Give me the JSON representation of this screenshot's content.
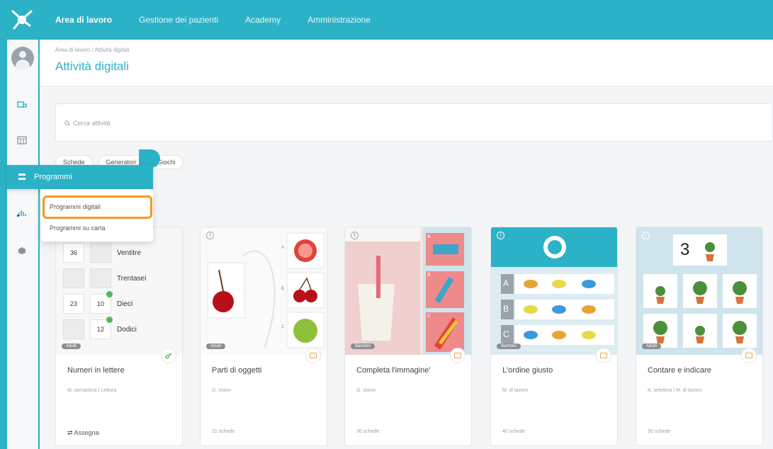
{
  "topnav": {
    "items": [
      {
        "label": "Area di lavoro",
        "active": true
      },
      {
        "label": "Gestione dei pazienti",
        "active": false
      },
      {
        "label": "Academy",
        "active": false
      },
      {
        "label": "Amministrazione",
        "active": false
      }
    ]
  },
  "breadcrumb": "Area di lavoro / Attività digitali",
  "page_title": "Attività digitali",
  "search": {
    "placeholder": "Cerca attività"
  },
  "filters": [
    "Schede",
    "Generatori",
    "Giochi"
  ],
  "sidebar_menu": {
    "label": "Programmi",
    "submenu": [
      "Programmi digitali",
      "Programmi su carta"
    ]
  },
  "cards": [
    {
      "title": "Numeri in lettere",
      "meta": "M. semantica | Lettura",
      "footer": "Assegna",
      "badge": "Adulti",
      "rows": [
        {
          "left": "36",
          "right": "",
          "word": "Ventitre"
        },
        {
          "left": "",
          "right": "",
          "word": "Trentasei"
        },
        {
          "left": "23",
          "right": "10",
          "word": "Dieci"
        },
        {
          "left": "",
          "right": "12",
          "word": "Dodici"
        }
      ]
    },
    {
      "title": "Parti di oggetti",
      "meta": "G. visivo",
      "footer": "21 schede",
      "badge": "Adulti"
    },
    {
      "title": "Completa l'immagine'",
      "meta": "G. visivo",
      "footer": "30 schede",
      "badge": "Bambini"
    },
    {
      "title": "L'ordine giusto",
      "meta": "M. di lavoro",
      "footer": "40 schede",
      "badge": "Bambini",
      "rows": [
        "A",
        "B",
        "C"
      ]
    },
    {
      "title": "Contare e indicare",
      "meta": "A. selettiva | M. di lavoro",
      "footer": "30 schede",
      "badge": "Adulti",
      "counter": "3"
    }
  ],
  "colors": {
    "accent": "#2cb2c6",
    "highlight": "#f39a1f"
  }
}
